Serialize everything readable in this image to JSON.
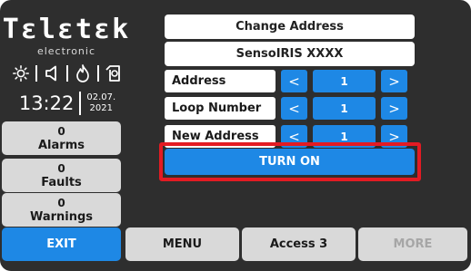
{
  "brand": {
    "name": "Tεlεtεk",
    "tagline": "electronic"
  },
  "status_icons": [
    "sun-icon",
    "speaker-icon",
    "fire-icon",
    "siren-icon"
  ],
  "clock": {
    "time": "13:22",
    "date_line1": "02.07.",
    "date_line2": "2021"
  },
  "counters": [
    {
      "count": "0",
      "label": "Alarms"
    },
    {
      "count": "0",
      "label": "Faults"
    },
    {
      "count": "0",
      "label": "Warnings"
    }
  ],
  "main": {
    "title": "Change Address",
    "device": "SensoIRIS XXXX",
    "rows": [
      {
        "label": "Address",
        "value": "1",
        "prev": "<",
        "next": ">"
      },
      {
        "label": "Loop Number",
        "value": "1",
        "prev": "<",
        "next": ">"
      },
      {
        "label": "New Address",
        "value": "1",
        "prev": "<",
        "next": ">"
      }
    ],
    "turn_on_label": "TURN ON"
  },
  "bottom": {
    "exit": "EXIT",
    "menu": "MENU",
    "access": "Access 3",
    "more": "MORE"
  },
  "colors": {
    "background": "#2e2e2e",
    "accent_blue": "#1e88e5",
    "highlight_red": "#e31b23",
    "button_gray": "#d9d9d9"
  }
}
